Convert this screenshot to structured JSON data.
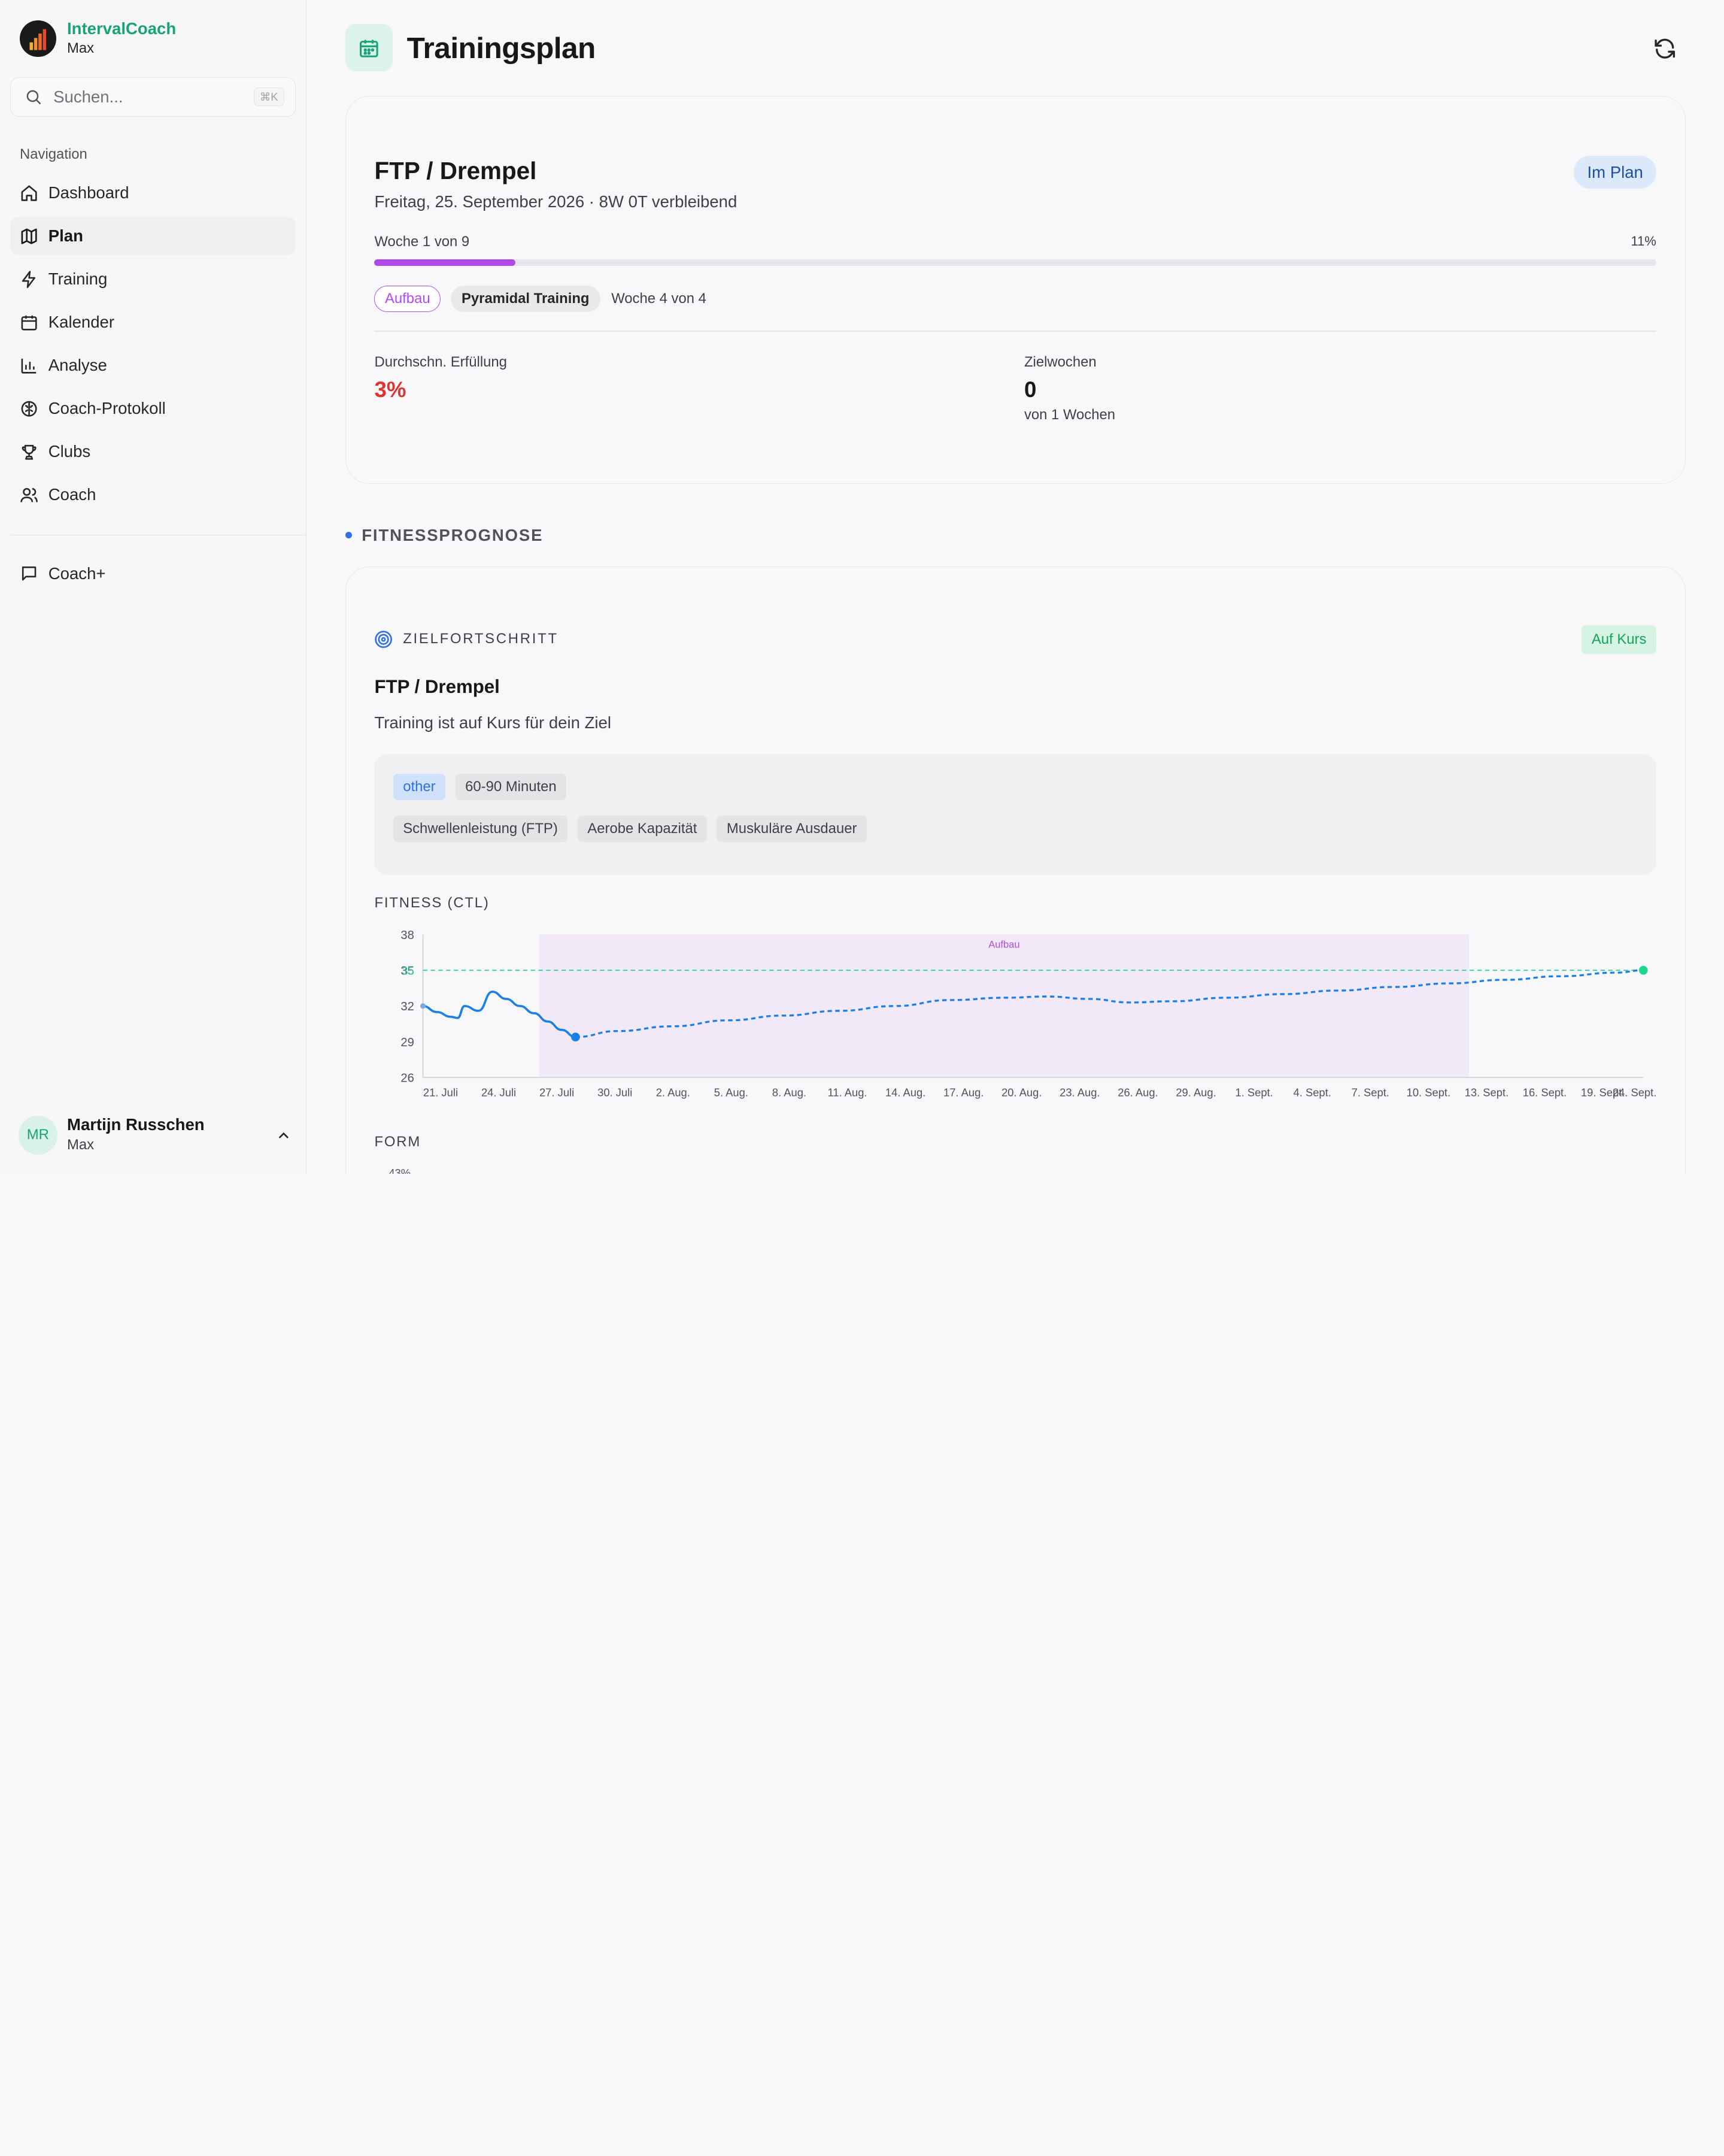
{
  "app": {
    "name": "IntervalCoach",
    "subtitle": "Max"
  },
  "search": {
    "placeholder": "Suchen...",
    "shortcut": "⌘K"
  },
  "nav": {
    "section_label": "Navigation",
    "items": [
      {
        "label": "Dashboard",
        "icon": "home-icon"
      },
      {
        "label": "Plan",
        "icon": "map-icon",
        "active": true
      },
      {
        "label": "Training",
        "icon": "zap-icon"
      },
      {
        "label": "Kalender",
        "icon": "calendar-icon"
      },
      {
        "label": "Analyse",
        "icon": "bar-chart-icon"
      },
      {
        "label": "Coach-Protokoll",
        "icon": "brain-icon"
      },
      {
        "label": "Clubs",
        "icon": "trophy-icon"
      },
      {
        "label": "Coach",
        "icon": "users-icon"
      }
    ],
    "extra": {
      "label": "Coach+",
      "icon": "message-square-icon"
    }
  },
  "user": {
    "initials": "MR",
    "name": "Martijn Russchen",
    "subtitle": "Max"
  },
  "page": {
    "title": "Trainingsplan",
    "icon": "calendar-icon"
  },
  "plan": {
    "title": "FTP / Drempel",
    "subtitle": "Freitag, 25. September 2026 · 8W 0T verbleibend",
    "status": "Im Plan",
    "week_label": "Woche 1 von 9",
    "progress_text": "11%",
    "progress": 0.11,
    "phase": "Aufbau",
    "block": "Pyramidal Training",
    "block_week": "Woche 4 von 4",
    "stats": {
      "fulfilment_label": "Durchschn. Erfüllung",
      "fulfilment_value": "3%",
      "target_weeks_label": "Zielwochen",
      "target_weeks_value": "0",
      "target_weeks_sub": "von 1 Wochen"
    }
  },
  "forecast": {
    "section_title": "FITNESSPROGNOSE",
    "goal_label": "ZIELFORTSCHRITT",
    "status": "Auf Kurs",
    "title": "FTP / Drempel",
    "subtitle": "Training ist auf Kurs für dein Ziel",
    "tags_row1": [
      {
        "label": "other",
        "style": "blue"
      },
      {
        "label": "60-90 Minuten",
        "style": "grey"
      }
    ],
    "tags_row2": [
      "Schwellenleistung (FTP)",
      "Aerobe Kapazität",
      "Muskuläre Ausdauer"
    ],
    "form_label": "FORM",
    "form_first_tick": "43%"
  },
  "chart_data": {
    "type": "line",
    "title": "FITNESS (CTL)",
    "ylim": [
      26,
      38
    ],
    "yticks": [
      38,
      35,
      32,
      29,
      26
    ],
    "target_value": 35,
    "target_label": "35",
    "band_label": "Aufbau",
    "band_range": [
      "27. Juli",
      "13. Sept."
    ],
    "x_labels": [
      "21. Juli",
      "24. Juli",
      "27. Juli",
      "30. Juli",
      "2. Aug.",
      "5. Aug.",
      "8. Aug.",
      "11. Aug.",
      "14. Aug.",
      "17. Aug.",
      "20. Aug.",
      "23. Aug.",
      "26. Aug.",
      "29. Aug.",
      "1. Sept.",
      "4. Sept.",
      "7. Sept.",
      "10. Sept.",
      "13. Sept.",
      "16. Sept.",
      "19. Sept.",
      "24. Sept."
    ],
    "series": [
      {
        "style": "solid",
        "points": [
          [
            0,
            32.0
          ],
          [
            1,
            31.5
          ],
          [
            2,
            31.1
          ],
          [
            2.5,
            31.0
          ],
          [
            3,
            32.0
          ],
          [
            4,
            31.6
          ],
          [
            5,
            33.2
          ],
          [
            6,
            32.6
          ],
          [
            7,
            32.0
          ],
          [
            8,
            31.4
          ],
          [
            9,
            30.7
          ],
          [
            10,
            30.0
          ],
          [
            11,
            29.4
          ]
        ]
      },
      {
        "style": "dashed",
        "points": [
          [
            11,
            29.4
          ],
          [
            14,
            29.9
          ],
          [
            18,
            30.3
          ],
          [
            22,
            30.8
          ],
          [
            26,
            31.2
          ],
          [
            30,
            31.6
          ],
          [
            34,
            32.0
          ],
          [
            38,
            32.5
          ],
          [
            42,
            32.7
          ],
          [
            45,
            32.8
          ],
          [
            48,
            32.6
          ],
          [
            51,
            32.3
          ],
          [
            54,
            32.4
          ],
          [
            58,
            32.7
          ],
          [
            62,
            33.0
          ],
          [
            66,
            33.3
          ],
          [
            70,
            33.6
          ],
          [
            74,
            33.9
          ],
          [
            78,
            34.2
          ],
          [
            82,
            34.5
          ],
          [
            86,
            34.8
          ],
          [
            88,
            35.0
          ]
        ]
      }
    ],
    "colors": {
      "line": "#1a7fe6",
      "target": "#2ed3a0",
      "band": "#f1e8f8",
      "band_label": "#b14ae8",
      "end_point": "#1fd68f"
    }
  }
}
